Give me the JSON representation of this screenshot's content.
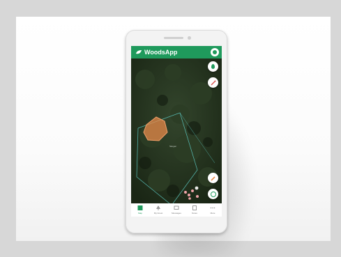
{
  "app": {
    "title": "WoodsApp"
  },
  "map": {
    "area_label": "Skogen"
  },
  "nav": [
    {
      "label": "Map"
    },
    {
      "label": "My forest"
    },
    {
      "label": "Messages"
    },
    {
      "label": "Notes"
    },
    {
      "label": "More"
    }
  ],
  "colors": {
    "brand": "#1f9a5c",
    "highlight": "#e88a4a",
    "boundary": "#5cc7c0",
    "marker": "#f0a4a8"
  }
}
